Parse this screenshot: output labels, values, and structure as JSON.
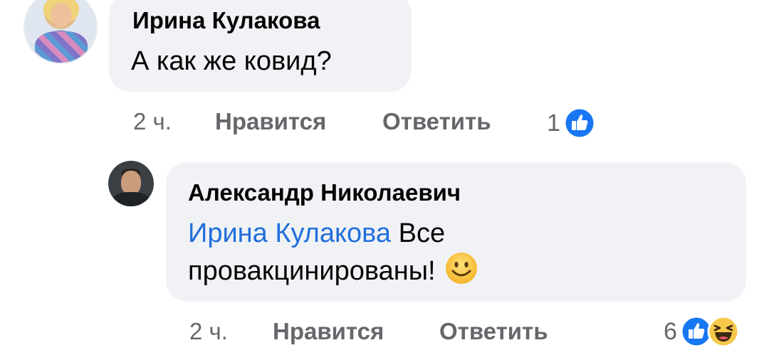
{
  "comments": [
    {
      "author": "Ирина Кулакова",
      "text": "А как же ковид?",
      "time": "2 ч.",
      "like_label": "Нравится",
      "reply_label": "Ответить",
      "reaction_count": "1",
      "reactions": [
        "like-icon"
      ]
    },
    {
      "author": "Александр Николаевич",
      "mention": "Ирина Кулакова",
      "text_line1": "Все",
      "text_line2": "провакцинированы!",
      "emoji": "smiling-face-icon",
      "time": "2 ч.",
      "like_label": "Нравится",
      "reply_label": "Ответить",
      "reaction_count": "6",
      "reactions": [
        "like-icon",
        "haha-icon"
      ]
    }
  ],
  "colors": {
    "bubble_bg": "#f0f2f5",
    "mention": "#216fdb",
    "meta": "#65676b",
    "like_blue": "#1877f2",
    "haha_yellow": "#f7c84a"
  }
}
